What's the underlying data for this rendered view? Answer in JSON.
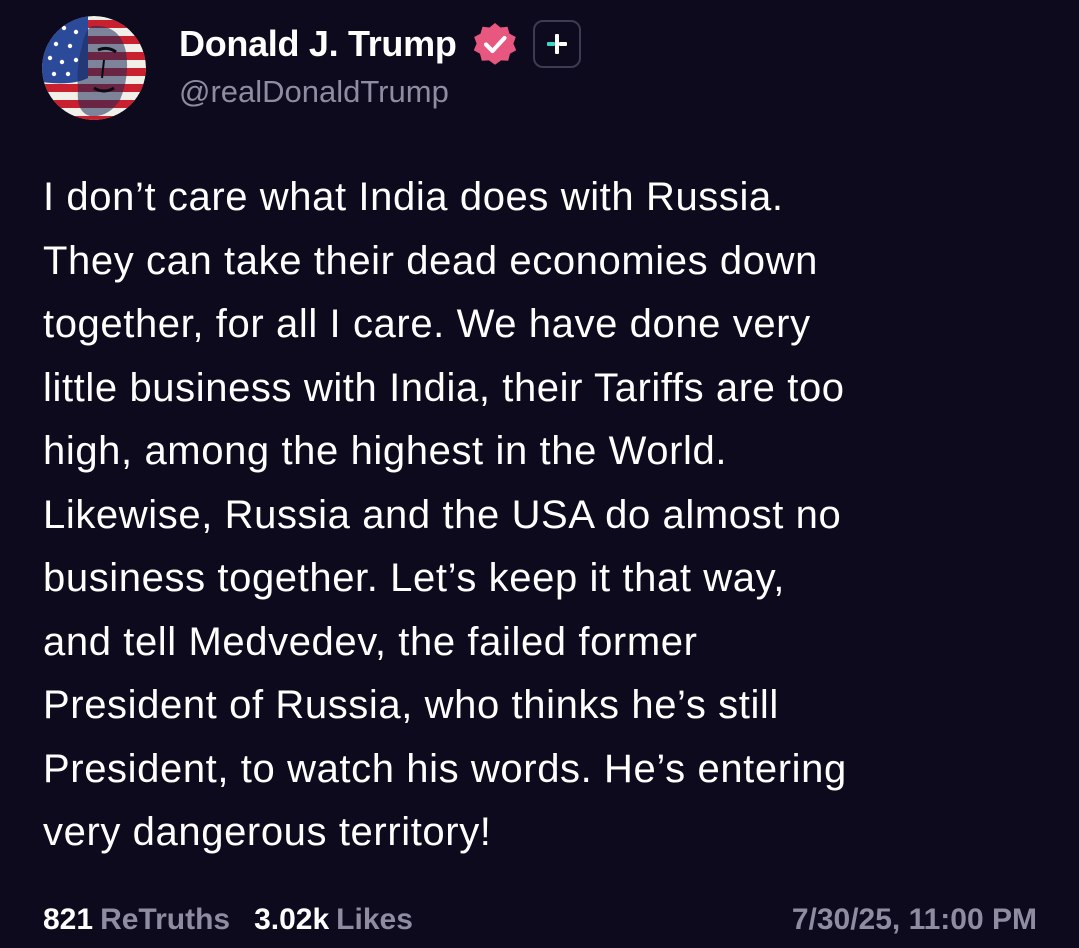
{
  "author": {
    "display_name": "Donald J. Trump",
    "handle": "@realDonaldTrump",
    "avatar_icon": "flag-portrait-avatar",
    "verified_icon": "verified-check-icon",
    "verified_color": "#e8577f",
    "plus_icon": "plus-badge-icon",
    "plus_color": "#3ad6c8"
  },
  "post": {
    "lines": [
      "I don’t care what India does with Russia.",
      "They can take their dead economies down",
      "together, for all I care. We have done very",
      "little business with India, their Tariffs are too",
      "high, among the highest in the World.",
      "Likewise, Russia and the USA do almost no",
      "business together. Let’s keep it that way,",
      "and tell Medvedev, the failed former",
      "President of Russia, who thinks he’s still",
      "President, to watch his words. He’s entering",
      "very dangerous territory!"
    ]
  },
  "stats": {
    "retruths_count": "821",
    "retruths_label": "ReTruths",
    "likes_count": "3.02k",
    "likes_label": "Likes"
  },
  "timestamp": "7/30/25, 11:00 PM",
  "colors": {
    "background": "#0c0a1c",
    "text": "#ffffff",
    "muted": "#8e8ca1"
  }
}
